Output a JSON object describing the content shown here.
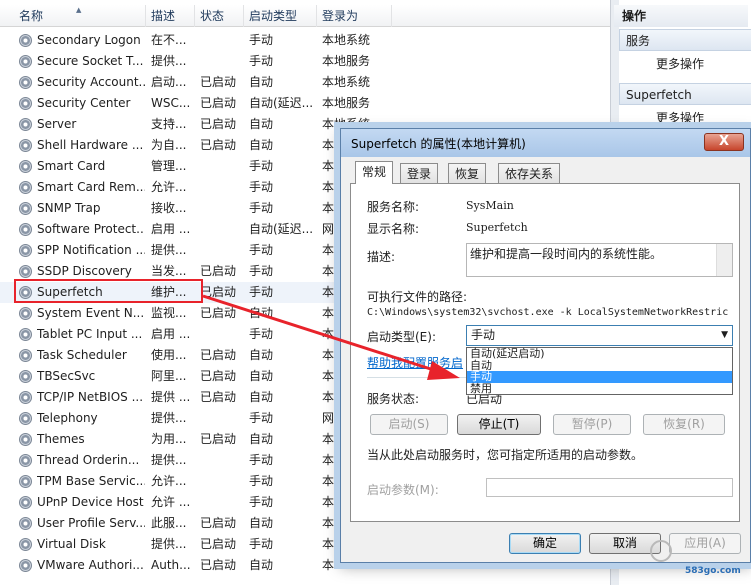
{
  "services": {
    "columns": [
      "名称",
      "描述",
      "状态",
      "启动类型",
      "登录为"
    ],
    "rows": [
      {
        "name": "Secondary Logon",
        "desc": "在不...",
        "status": "",
        "startup": "手动",
        "logon": "本地系统"
      },
      {
        "name": "Secure Socket T...",
        "desc": "提供...",
        "status": "",
        "startup": "手动",
        "logon": "本地服务"
      },
      {
        "name": "Security Account...",
        "desc": "启动...",
        "status": "已启动",
        "startup": "自动",
        "logon": "本地系统"
      },
      {
        "name": "Security Center",
        "desc": "WSC...",
        "status": "已启动",
        "startup": "自动(延迟...",
        "logon": "本地服务"
      },
      {
        "name": "Server",
        "desc": "支持...",
        "status": "已启动",
        "startup": "自动",
        "logon": "本地系统"
      },
      {
        "name": "Shell Hardware ...",
        "desc": "为自...",
        "status": "已启动",
        "startup": "自动",
        "logon": "本地系统"
      },
      {
        "name": "Smart Card",
        "desc": "管理...",
        "status": "",
        "startup": "手动",
        "logon": "本"
      },
      {
        "name": "Smart Card Rem...",
        "desc": "允许...",
        "status": "",
        "startup": "手动",
        "logon": "本"
      },
      {
        "name": "SNMP Trap",
        "desc": "接收...",
        "status": "",
        "startup": "手动",
        "logon": "本"
      },
      {
        "name": "Software Protect...",
        "desc": "启用 ...",
        "status": "",
        "startup": "自动(延迟...",
        "logon": "网络"
      },
      {
        "name": "SPP Notification ...",
        "desc": "提供...",
        "status": "",
        "startup": "手动",
        "logon": "本"
      },
      {
        "name": "SSDP Discovery",
        "desc": "当发...",
        "status": "已启动",
        "startup": "手动",
        "logon": "本"
      },
      {
        "name": "Superfetch",
        "desc": "维护...",
        "status": "已启动",
        "startup": "手动",
        "logon": "本"
      },
      {
        "name": "System Event N...",
        "desc": "监视...",
        "status": "已启动",
        "startup": "自动",
        "logon": "本"
      },
      {
        "name": "Tablet PC Input ...",
        "desc": "启用 ...",
        "status": "",
        "startup": "手动",
        "logon": "本"
      },
      {
        "name": "Task Scheduler",
        "desc": "使用...",
        "status": "已启动",
        "startup": "自动",
        "logon": "本"
      },
      {
        "name": "TBSecSvc",
        "desc": "阿里...",
        "status": "已启动",
        "startup": "自动",
        "logon": "本"
      },
      {
        "name": "TCP/IP NetBIOS ...",
        "desc": "提供 ...",
        "status": "已启动",
        "startup": "自动",
        "logon": "本"
      },
      {
        "name": "Telephony",
        "desc": "提供...",
        "status": "",
        "startup": "手动",
        "logon": "网络"
      },
      {
        "name": "Themes",
        "desc": "为用...",
        "status": "已启动",
        "startup": "自动",
        "logon": "本"
      },
      {
        "name": "Thread Orderin...",
        "desc": "提供...",
        "status": "",
        "startup": "手动",
        "logon": "本"
      },
      {
        "name": "TPM Base Servic...",
        "desc": "允许...",
        "status": "",
        "startup": "手动",
        "logon": "本"
      },
      {
        "name": "UPnP Device Host",
        "desc": "允许 ...",
        "status": "",
        "startup": "手动",
        "logon": "本"
      },
      {
        "name": "User Profile Serv...",
        "desc": "此服...",
        "status": "已启动",
        "startup": "自动",
        "logon": "本"
      },
      {
        "name": "Virtual Disk",
        "desc": "提供...",
        "status": "已启动",
        "startup": "手动",
        "logon": "本"
      },
      {
        "name": "VMware Authori...",
        "desc": "Auth...",
        "status": "已启动",
        "startup": "自动",
        "logon": "本"
      }
    ],
    "selected_index": 12
  },
  "actions": {
    "header": "操作",
    "section1": "服务",
    "section1_item": "更多操作",
    "section2": "Superfetch",
    "section2_item": "更多操作"
  },
  "dialog": {
    "title": "Superfetch 的属性(本地计算机)",
    "close": "X",
    "tabs": [
      "常规",
      "登录",
      "恢复",
      "依存关系"
    ],
    "service_name_label": "服务名称:",
    "service_name": "SysMain",
    "display_name_label": "显示名称:",
    "display_name": "Superfetch",
    "description_label": "描述:",
    "description": "维护和提高一段时间内的系统性能。",
    "path_label": "可执行文件的路径:",
    "path": "C:\\Windows\\system32\\svchost.exe -k LocalSystemNetworkRestric",
    "startup_type_label": "启动类型(E):",
    "startup_type_value": "手动",
    "startup_options": [
      "自动(延迟启动)",
      "自动",
      "手动",
      "禁用"
    ],
    "startup_selected_index": 2,
    "help_link": "帮助我配置服务启",
    "status_label": "服务状态:",
    "status_value": "已启动",
    "btn_start": "启动(S)",
    "btn_stop": "停止(T)",
    "btn_pause": "暂停(P)",
    "btn_resume": "恢复(R)",
    "hint": "当从此处启动服务时，您可指定所适用的启动参数。",
    "params_label": "启动参数(M):",
    "btn_ok": "确定",
    "btn_cancel": "取消",
    "btn_apply": "应用(A)"
  },
  "watermark": {
    "site": "583go.com"
  },
  "colors": {
    "highlight_red": "#e8232b",
    "selected_option": "#3399ff",
    "link": "#0066cc"
  }
}
